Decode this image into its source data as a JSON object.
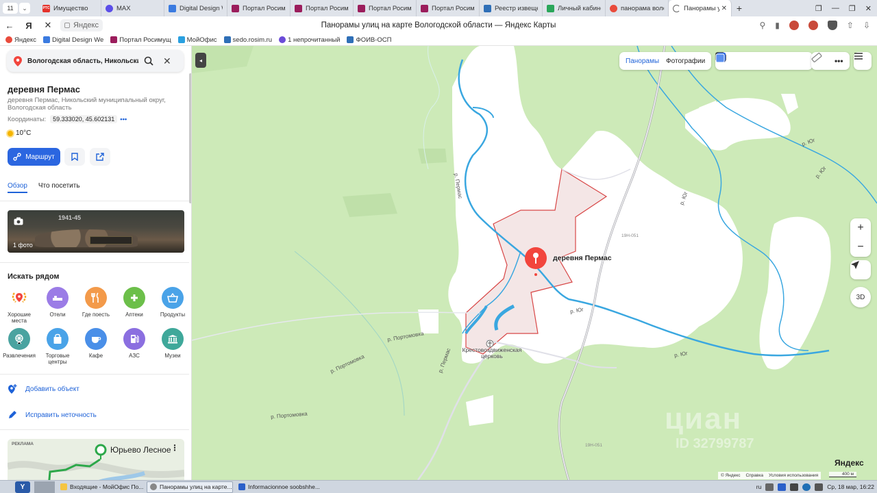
{
  "browser": {
    "tab_count": "11",
    "tabs": [
      {
        "label": "Имущество",
        "favicon_text": "РТС",
        "favicon_color": "#e4322b"
      },
      {
        "label": "MAX",
        "favicon_text": "",
        "favicon_color": "#5b4ee8"
      },
      {
        "label": "Digital Design W",
        "favicon_text": "",
        "favicon_color": "#3b7be0"
      },
      {
        "label": "Портал Росиму",
        "favicon_text": "",
        "favicon_color": "#9b1d5c"
      },
      {
        "label": "Портал Росиму",
        "favicon_text": "",
        "favicon_color": "#9b1d5c"
      },
      {
        "label": "Портал Росиму",
        "favicon_text": "",
        "favicon_color": "#9b1d5c"
      },
      {
        "label": "Портал Росиму",
        "favicon_text": "",
        "favicon_color": "#9b1d5c"
      },
      {
        "label": "Реестр извеще",
        "favicon_text": "",
        "favicon_color": "#2f6fb7"
      },
      {
        "label": "Личный кабине",
        "favicon_text": "",
        "favicon_color": "#2aa65a"
      },
      {
        "label": "панорама воло",
        "favicon_text": "",
        "favicon_color": "#e94b3c"
      },
      {
        "label": "Панорамы ул",
        "favicon_text": "",
        "favicon_color": "#888888",
        "active": true
      }
    ],
    "address_domain": "Яндекс",
    "page_title": "Панорамы улиц на карте Вологодской области — Яндекс Карты",
    "bookmarks": [
      {
        "label": "Яндекс",
        "color": "#e94b3c"
      },
      {
        "label": "Digital Design We",
        "color": "#3b7be0"
      },
      {
        "label": "Портал Росимущ",
        "color": "#9b1d5c"
      },
      {
        "label": "МойОфис",
        "color": "#2aa0e0"
      },
      {
        "label": "sedo.rosim.ru",
        "color": "#2f6fb7"
      },
      {
        "label": "1 непрочитанный",
        "color": "#6b4bd8"
      },
      {
        "label": "ФОИВ-ОСП",
        "color": "#2f6fb7"
      }
    ]
  },
  "sidebar": {
    "search_value": "Вологодская область, Никольский р",
    "place_title": "деревня Пермас",
    "place_subtitle": "деревня Пермас, Никольский муниципальный округ, Вологодская область",
    "coords_label": "Координаты:",
    "coords_value": "59.333020, 45.602131",
    "weather": "10°C",
    "route_button": "Маршрут",
    "tabs": [
      "Обзор",
      "Что посетить"
    ],
    "photo_count": "1 фото",
    "photo_caption_year": "1941-45",
    "nearby_title": "Искать рядом",
    "categories": [
      {
        "label": "Хорошие места",
        "color": "#ffffff",
        "icon": "laurel-icon"
      },
      {
        "label": "Отели",
        "color": "#9b7ce6",
        "icon": "bed-icon"
      },
      {
        "label": "Где поесть",
        "color": "#f39a4a",
        "icon": "fork-knife-icon"
      },
      {
        "label": "Аптеки",
        "color": "#6cbf4a",
        "icon": "plus-icon"
      },
      {
        "label": "Продукты",
        "color": "#4aa3e8",
        "icon": "basket-icon"
      },
      {
        "label": "Развлечения",
        "color": "#4aa3a0",
        "icon": "ferris-wheel-icon"
      },
      {
        "label": "Торговые центры",
        "color": "#4aa3e8",
        "icon": "shopping-bag-icon"
      },
      {
        "label": "Кафе",
        "color": "#4a8fe8",
        "icon": "cup-icon"
      },
      {
        "label": "АЗС",
        "color": "#8b6fe0",
        "icon": "fuel-icon"
      },
      {
        "label": "Музеи",
        "color": "#3fa89a",
        "icon": "museum-icon"
      }
    ],
    "add_object": "Добавить объект",
    "fix_error": "Исправить неточность",
    "ad_label": "РЕКЛАМА",
    "ad_town": "Юрьево Лесное"
  },
  "map": {
    "layer_toggle": [
      "Панорамы",
      "Фотографии"
    ],
    "place_label": "деревня Пермас",
    "church_label": "Крестовоздвиженская церковь",
    "road_labels": [
      "р. Портомовка",
      "р. Портомовка",
      "р. Портомовка",
      "р. Пермас",
      "р. Пермас",
      "р. Юг",
      "р. Юг",
      "р. Юг",
      "р. Юг",
      "р. Юг"
    ],
    "road_numbers": [
      "19Н-051",
      "19Н-051"
    ],
    "watermark": "циан",
    "watermark_id": "ID 32799787",
    "zoom_in": "+",
    "zoom_out": "−",
    "btn_3d": "3D",
    "brand": "Яндекс",
    "copyright": [
      "© Яндекс",
      "Справка",
      "Условия использования"
    ],
    "scale": "400 м",
    "colors": {
      "forest": "#cdeab8",
      "field": "#ffffff",
      "river": "#3aa7e0",
      "settlement": "#f4e6e6",
      "border": "#d84646",
      "pin": "#f2453d"
    }
  },
  "taskbar": {
    "tasks": [
      {
        "label": "Входящие - МойОфис По...",
        "color": "#f5c542"
      },
      {
        "label": "Панорамы улиц на карте...",
        "color": "#888888",
        "active": true
      },
      {
        "label": "Informacionnoe soobshhe...",
        "color": "#2b5fc9"
      }
    ],
    "lang": "ru",
    "clock": "Ср, 18 мар, 16:22"
  }
}
